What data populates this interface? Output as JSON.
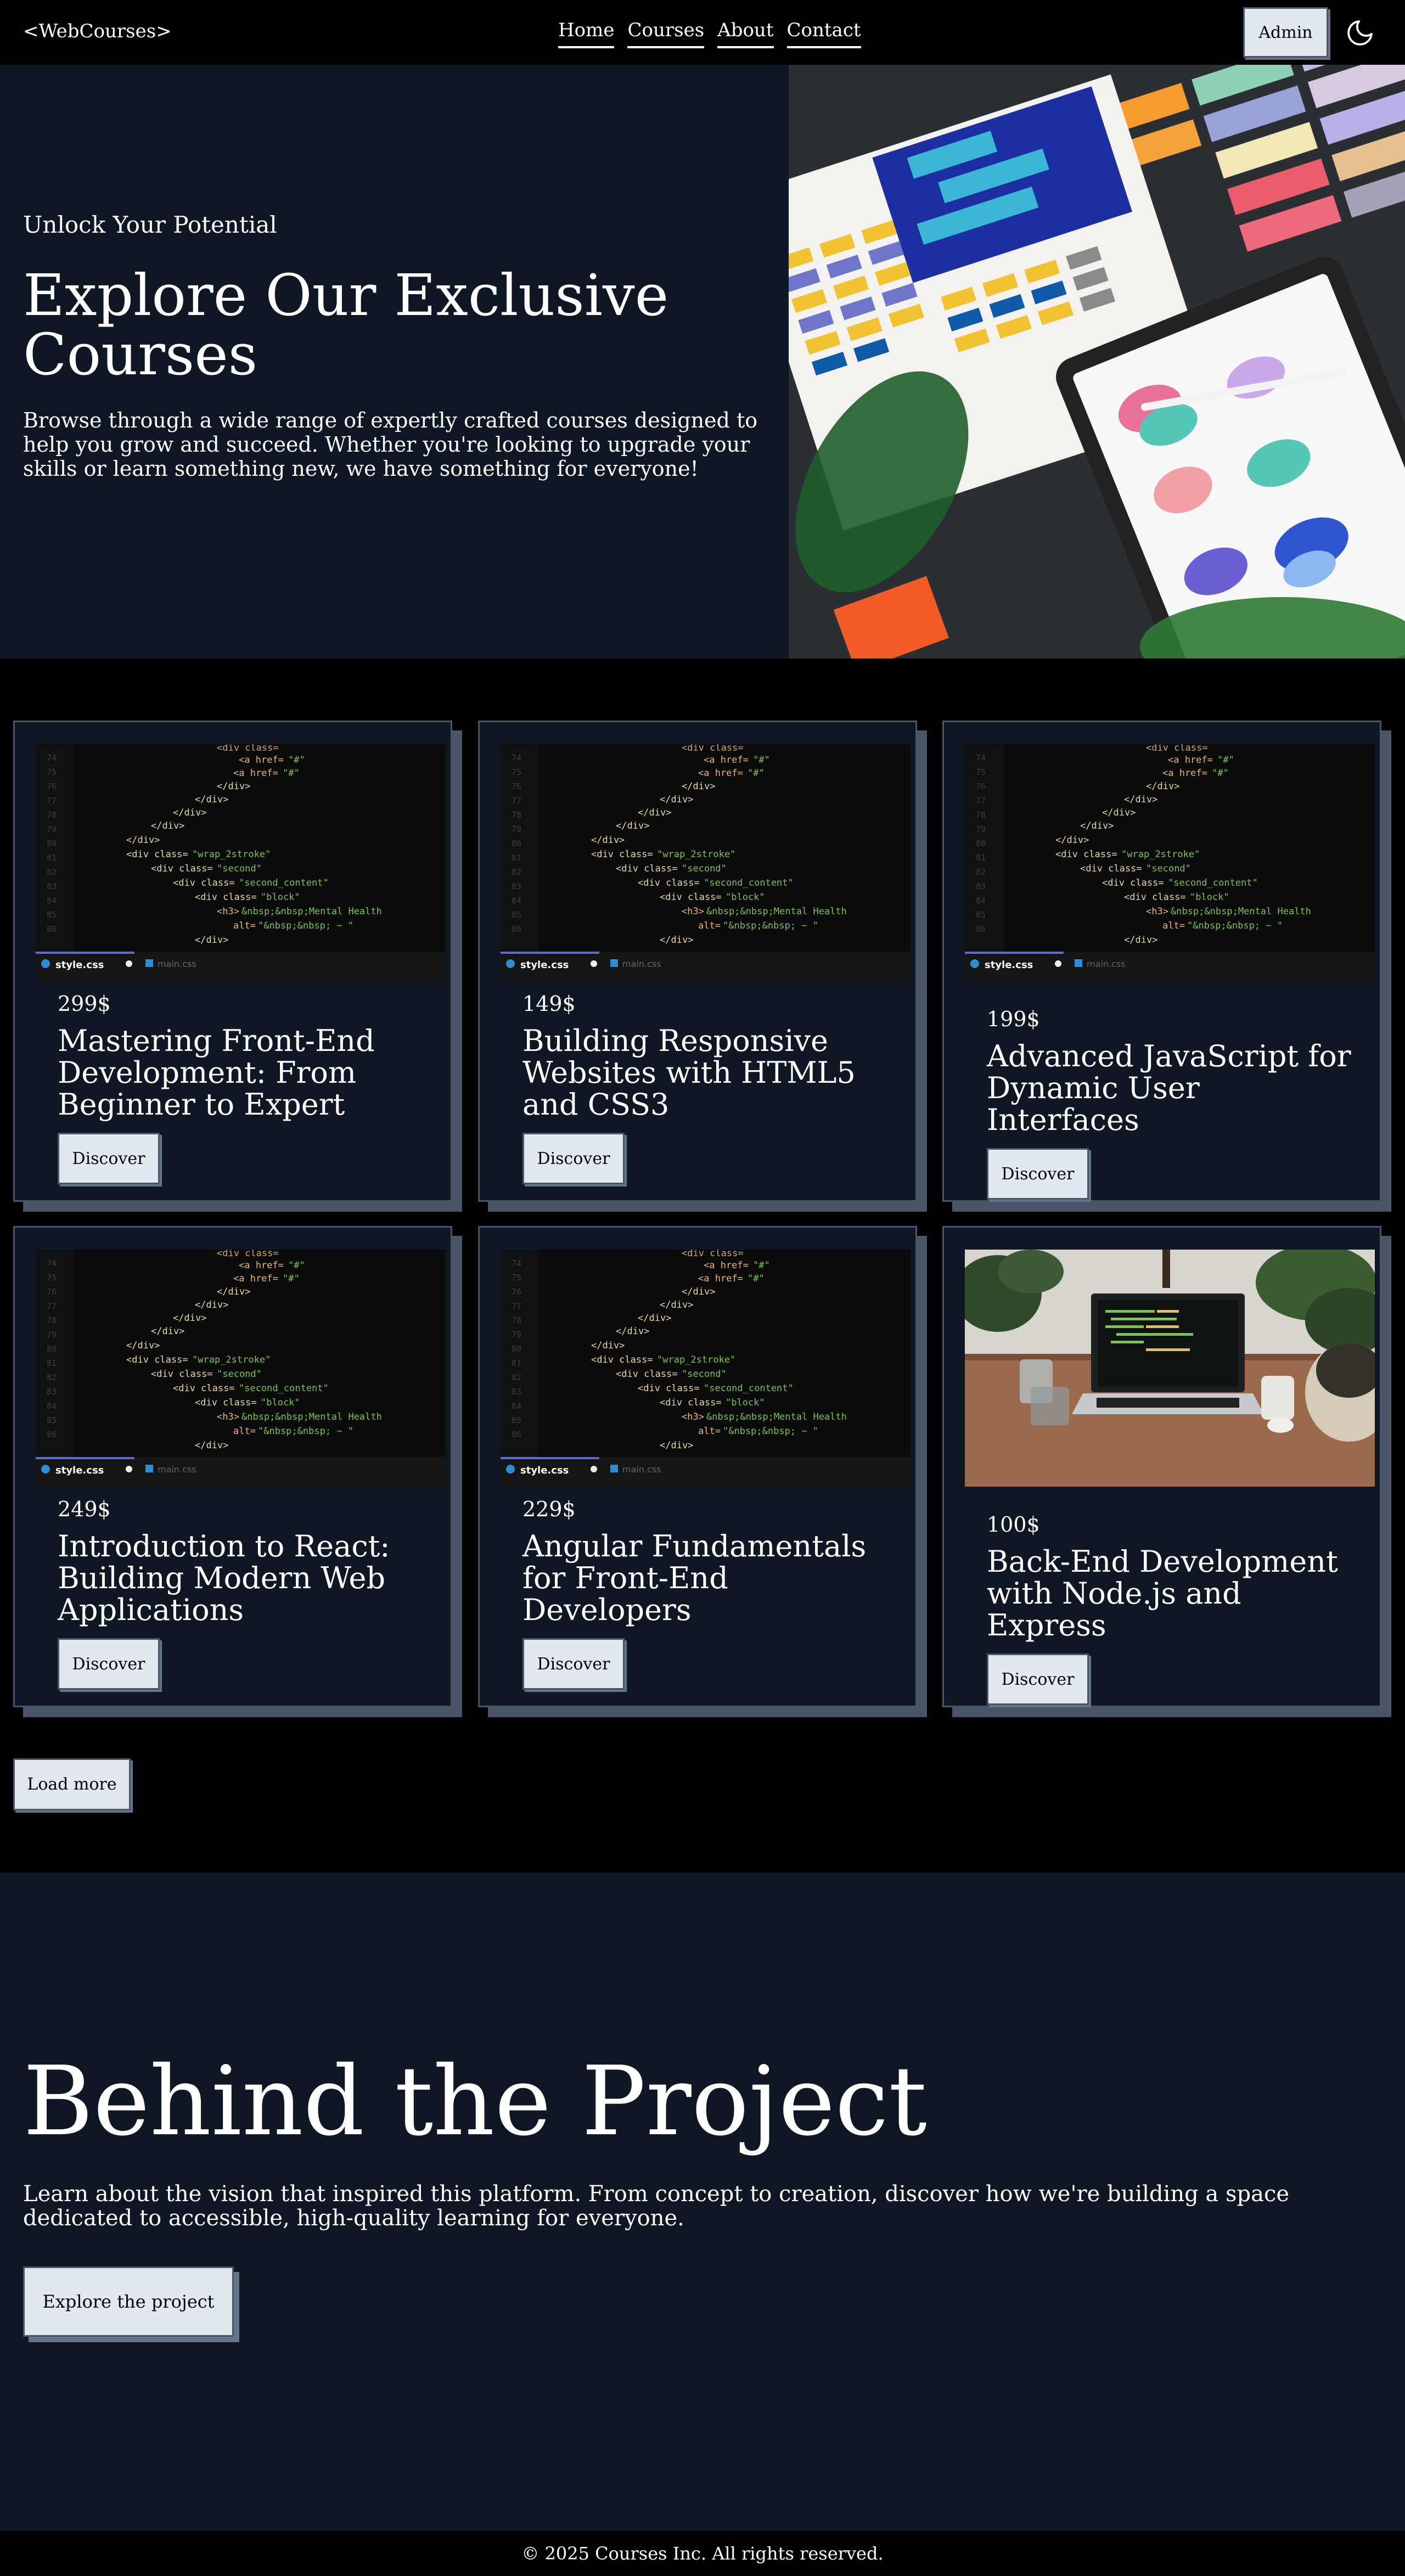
{
  "nav": {
    "logo": "<WebCourses>",
    "links": [
      "Home",
      "Courses",
      "About",
      "Contact"
    ],
    "admin_label": "Admin",
    "theme_icon": "moon-icon"
  },
  "hero": {
    "eyebrow": "Unlock Your Potential",
    "title": "Explore Our Exclusive Courses",
    "description": "Browse through a wide range of expertly crafted courses designed to help you grow and succeed. Whether you're looking to upgrade your skills or learn something new, we have something for everyone!",
    "image": "design-color-swatches-tablet-photo"
  },
  "courses": {
    "cards": [
      {
        "price": "299$",
        "title": "Mastering Front-End Development: From Beginner to Expert",
        "button": "Discover",
        "image": "code-editor-photo"
      },
      {
        "price": "149$",
        "title": "Building Responsive Websites with HTML5 and CSS3",
        "button": "Discover",
        "image": "code-editor-photo"
      },
      {
        "price": "199$",
        "title": "Advanced JavaScript for Dynamic User Interfaces",
        "button": "Discover",
        "image": "code-editor-photo"
      },
      {
        "price": "249$",
        "title": "Introduction to React: Building Modern Web Applications",
        "button": "Discover",
        "image": "code-editor-photo"
      },
      {
        "price": "229$",
        "title": "Angular Fundamentals for Front-End Developers",
        "button": "Discover",
        "image": "code-editor-photo"
      },
      {
        "price": "100$",
        "title": "Back-End Development with Node.js and Express",
        "button": "Discover",
        "image": "laptop-desk-photo"
      }
    ],
    "load_more": "Load more"
  },
  "about": {
    "title": "Behind the Project",
    "description": "Learn about the vision that inspired this platform. From concept to creation, discover how we're building a space dedicated to accessible, high-quality learning for everyone.",
    "button": "Explore the project"
  },
  "footer": {
    "text": "© 2025 Courses Inc. All rights reserved."
  },
  "colors": {
    "background": "#000000",
    "section_bg": "#0f1624",
    "button_bg": "#e2e8f0",
    "card_shadow": "#4a5568"
  }
}
